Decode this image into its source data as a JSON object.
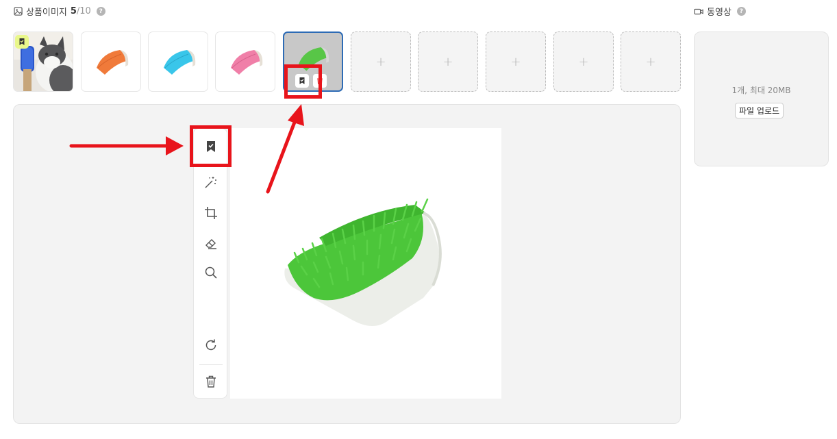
{
  "images_section": {
    "title": "상품이미지",
    "count_current": "5",
    "count_max": "/10",
    "help": "?"
  },
  "video_section": {
    "title": "동영상",
    "help": "?",
    "info": "1개, 최대 20MB",
    "upload_label": "파일 업로드"
  },
  "thumbnails": [
    {
      "kind": "photo",
      "subject": "cat with blue grooming brush",
      "representative": true
    },
    {
      "kind": "photo",
      "subject": "orange grooming brush",
      "color": "#f07a3a"
    },
    {
      "kind": "photo",
      "subject": "blue grooming brush",
      "color": "#39c6ea"
    },
    {
      "kind": "photo",
      "subject": "pink grooming brush",
      "color": "#f07fa8"
    },
    {
      "kind": "photo",
      "subject": "green grooming brush",
      "color": "#4cc63a",
      "selected": true
    }
  ],
  "empty_slot_label": "+",
  "toolbar_icons": [
    "bookmark-icon",
    "magic-wand-icon",
    "crop-icon",
    "eraser-icon",
    "search-icon",
    "rotate-icon",
    "trash-icon"
  ],
  "colors": {
    "accent_blue": "#2d6bb5",
    "annotation_red": "#e8141b",
    "rep_badge": "#e9f78a",
    "product_green": "#4cc63a"
  }
}
